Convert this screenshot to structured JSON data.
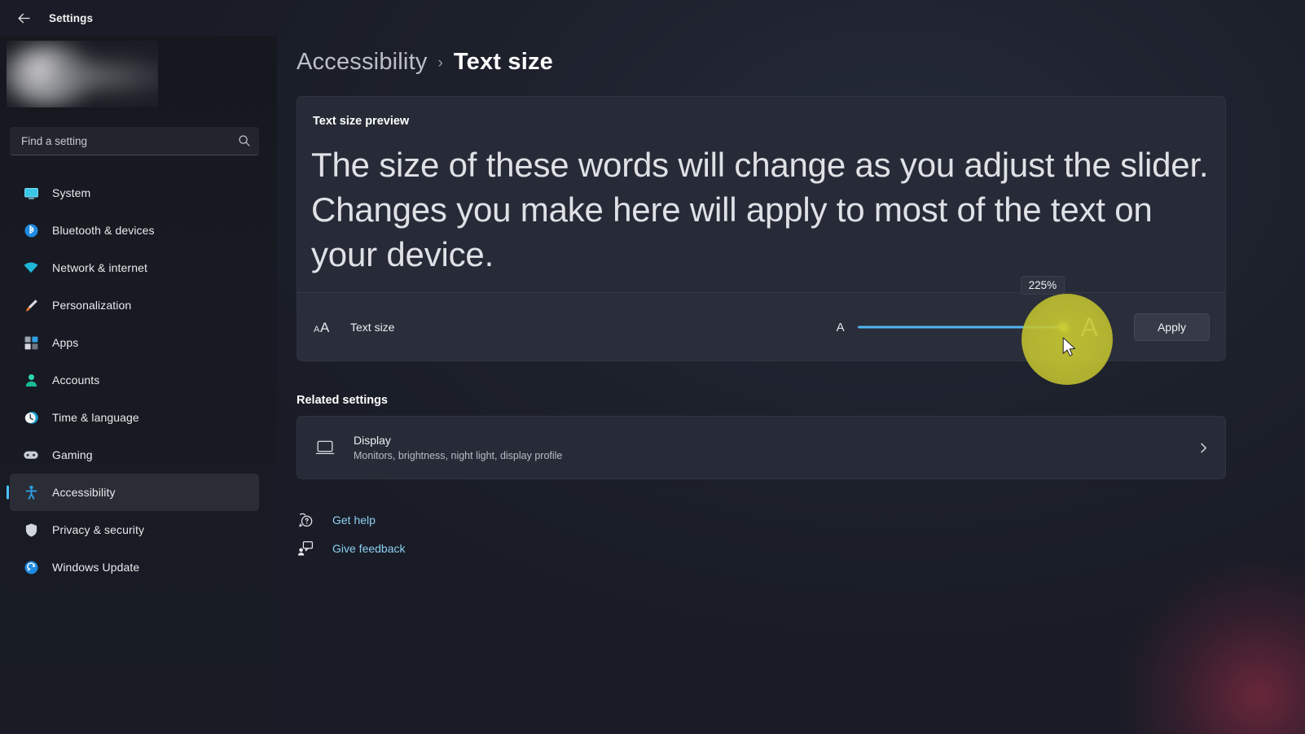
{
  "window": {
    "back_label": "Back",
    "title": "Settings"
  },
  "search": {
    "placeholder": "Find a setting",
    "icon": "search-icon"
  },
  "sidebar": {
    "items": [
      {
        "label": "System",
        "icon": "monitor-icon",
        "selected": false
      },
      {
        "label": "Bluetooth & devices",
        "icon": "bluetooth-icon",
        "selected": false
      },
      {
        "label": "Network & internet",
        "icon": "wifi-icon",
        "selected": false
      },
      {
        "label": "Personalization",
        "icon": "paintbrush-icon",
        "selected": false
      },
      {
        "label": "Apps",
        "icon": "apps-grid-icon",
        "selected": false
      },
      {
        "label": "Accounts",
        "icon": "person-icon",
        "selected": false
      },
      {
        "label": "Time & language",
        "icon": "clock-icon",
        "selected": false
      },
      {
        "label": "Gaming",
        "icon": "gamepad-icon",
        "selected": false
      },
      {
        "label": "Accessibility",
        "icon": "accessibility-person-icon",
        "selected": true
      },
      {
        "label": "Privacy & security",
        "icon": "shield-icon",
        "selected": false
      },
      {
        "label": "Windows Update",
        "icon": "refresh-circle-icon",
        "selected": false
      }
    ]
  },
  "breadcrumb": {
    "parent": "Accessibility",
    "separator": "›",
    "current": "Text size"
  },
  "preview": {
    "heading": "Text size preview",
    "body": "The size of these words will change as you adjust the slider. Changes you make here will apply to most of the text on your device."
  },
  "text_size": {
    "icon": "aa-text-size-icon",
    "label": "Text size",
    "small_marker": "A",
    "large_marker": "A",
    "value_tooltip": "225%",
    "value_percent": 225,
    "min_percent": 100,
    "max_percent": 225,
    "apply_label": "Apply",
    "track_color": "#51b6ef",
    "thumb_color": "#d8e060"
  },
  "related": {
    "section_title": "Related settings",
    "display": {
      "icon": "monitor-icon",
      "title": "Display",
      "subtitle": "Monitors, brightness, night light, display profile",
      "chevron": "chevron-right-icon"
    }
  },
  "footer_links": [
    {
      "label": "Get help",
      "icon": "help-question-icon"
    },
    {
      "label": "Give feedback",
      "icon": "feedback-person-icon"
    }
  ],
  "cursor": {
    "click_highlight_color": "#c8c832",
    "pointer": "mouse-arrow-cursor"
  }
}
